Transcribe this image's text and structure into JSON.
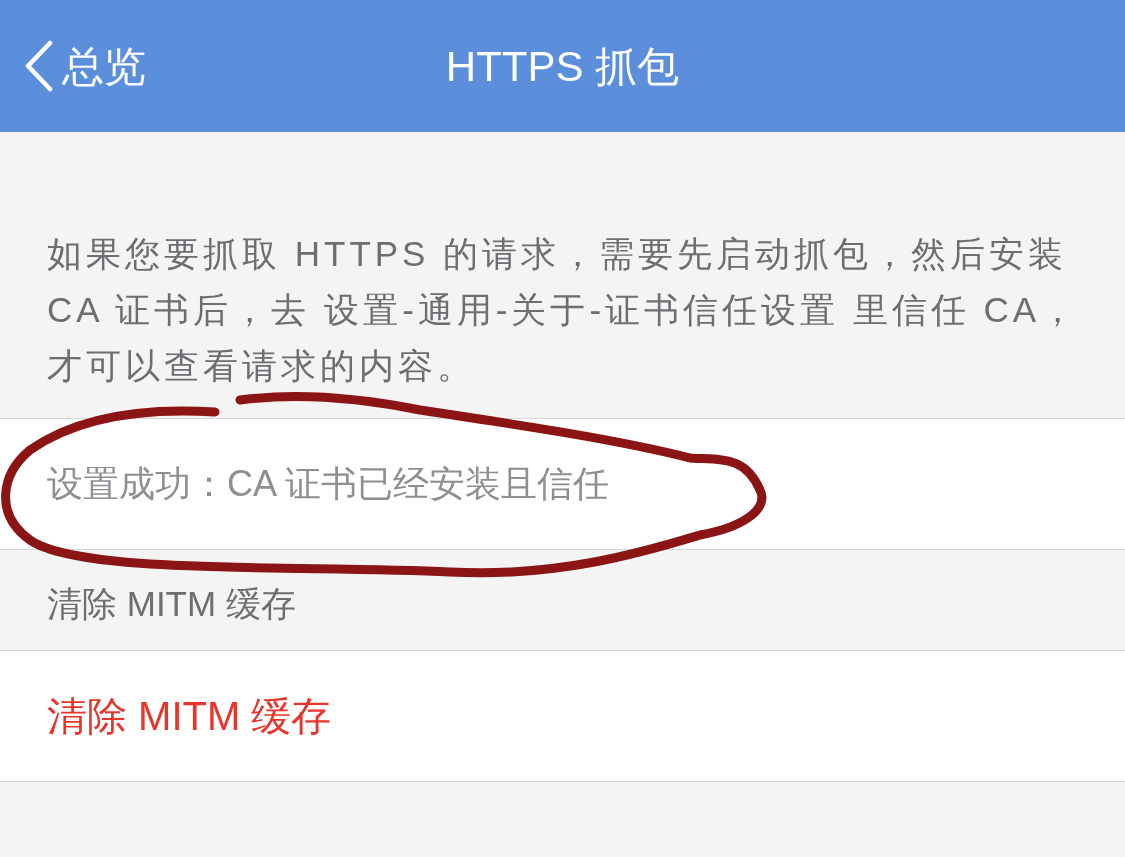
{
  "nav_bar": {
    "back_label": "总览",
    "title": "HTTPS 抓包"
  },
  "description": "如果您要抓取 HTTPS 的请求，需要先启动抓包，然后安装 CA 证书后，去 设置-通用-关于-证书信任设置 里信任 CA，才可以查看请求的内容。",
  "status_row": {
    "text": "设置成功：CA 证书已经安装且信任"
  },
  "sections": [
    {
      "header": "清除 MITM 缓存",
      "action": {
        "label": "清除 MITM 缓存",
        "kind": "destructive"
      }
    }
  ]
}
